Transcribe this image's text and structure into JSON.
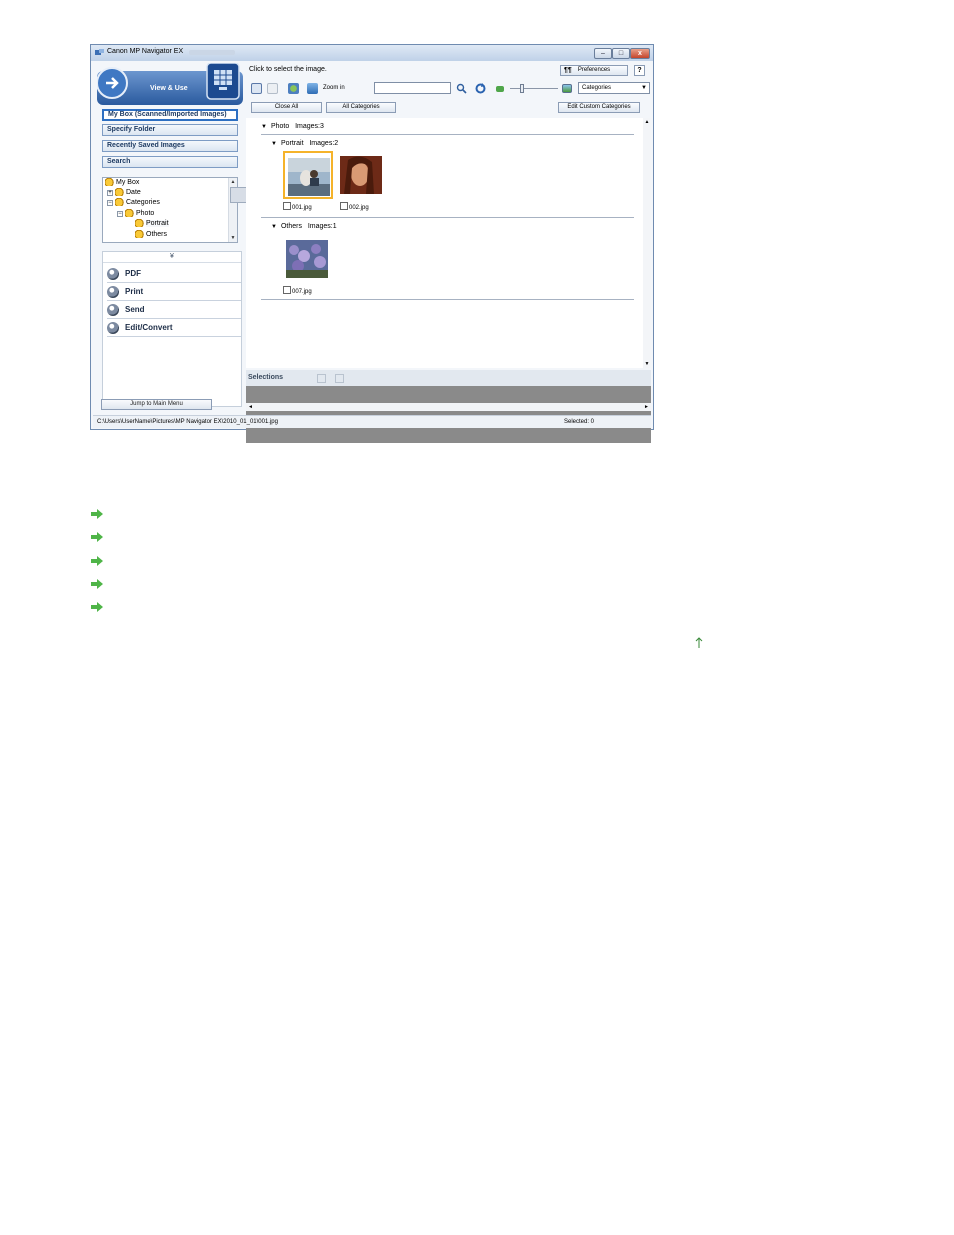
{
  "window": {
    "title": "Canon MP Navigator EX",
    "controls": {
      "minimize": "–",
      "maximize": "□",
      "close": "x"
    }
  },
  "left_panel": {
    "mode_label": "View & Use",
    "modes": [
      {
        "label": "My Box (Scanned/Imported Images)",
        "selected": true
      },
      {
        "label": "Specify Folder",
        "selected": false
      },
      {
        "label": "Recently Saved Images",
        "selected": false
      },
      {
        "label": "Search",
        "selected": false
      }
    ],
    "tree": [
      {
        "label": "My Box",
        "level": 0,
        "toggle": ""
      },
      {
        "label": "Date",
        "level": 1,
        "toggle": "+"
      },
      {
        "label": "Categories",
        "level": 1,
        "toggle": "−"
      },
      {
        "label": "Photo",
        "level": 2,
        "toggle": "−"
      },
      {
        "label": "Portrait",
        "level": 3,
        "toggle": ""
      },
      {
        "label": "Others",
        "level": 3,
        "toggle": ""
      }
    ],
    "collapse_glyph": "¥",
    "actions": [
      {
        "label": "PDF",
        "icon": "pdf-icon"
      },
      {
        "label": "Print",
        "icon": "print-icon"
      },
      {
        "label": "Send",
        "icon": "send-icon"
      },
      {
        "label": "Edit/Convert",
        "icon": "edit-icon"
      }
    ],
    "jump_label": "Jump to Main Menu"
  },
  "right_panel": {
    "hint": "Click to select the image.",
    "preferences_icon": "¶¶",
    "preferences_label": "Preferences",
    "help_label": "?",
    "zoom_label": "Zoom in",
    "search_value": "",
    "view_select": "Categories",
    "close_all_label": "Close All",
    "all_categories_label": "All Categories",
    "edit_categories_label": "Edit Custom Categories",
    "groups": {
      "photo": {
        "name": "Photo",
        "count": "Images:3"
      },
      "portrait": {
        "name": "Portrait",
        "count": "Images:2"
      },
      "others": {
        "name": "Others",
        "count": "Images:1"
      }
    },
    "files": [
      "001.jpg",
      "002.jpg",
      "007.jpg"
    ],
    "selections_label": "Selections"
  },
  "status": {
    "path": "C:\\Users\\UserName\\Pictures\\MP Navigator EX\\2010_01_01\\001.jpg",
    "selected": "Selected: 0"
  },
  "colors": {
    "accent": "#2d6fc2",
    "selection": "#f5b32a",
    "link_arrow": "#4fb548"
  }
}
